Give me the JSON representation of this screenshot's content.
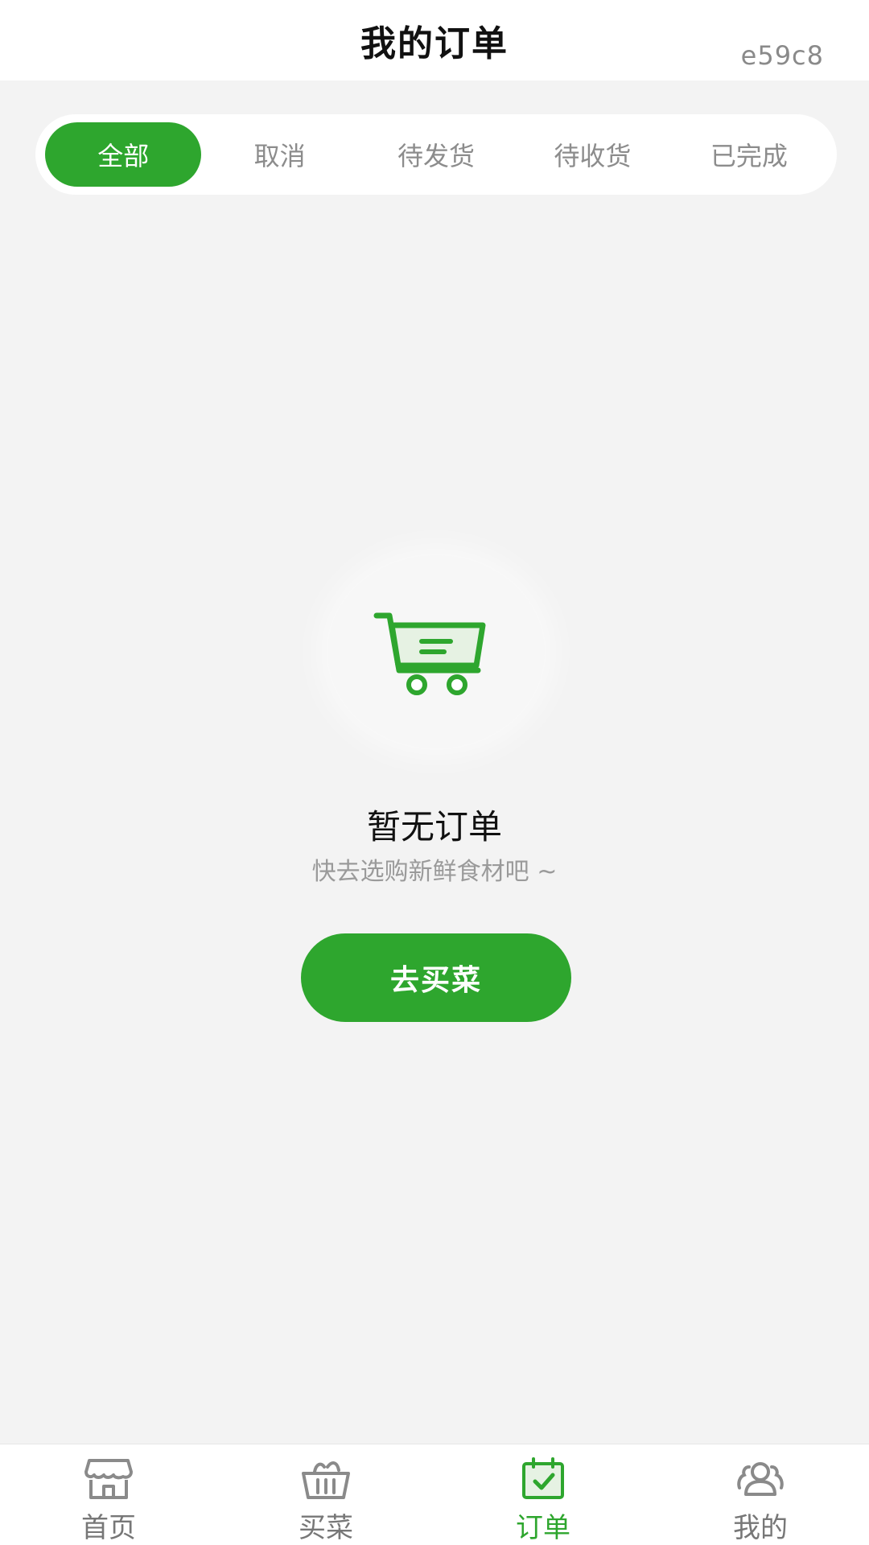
{
  "header": {
    "title": "我的订单",
    "build_id": "e59c8"
  },
  "tabs": [
    {
      "label": "全部",
      "active": true
    },
    {
      "label": "取消",
      "active": false
    },
    {
      "label": "待发货",
      "active": false
    },
    {
      "label": "待收货",
      "active": false
    },
    {
      "label": "已完成",
      "active": false
    }
  ],
  "empty_state": {
    "icon": "shopping-cart-icon",
    "title": "暂无订单",
    "subtitle": "快去选购新鲜食材吧 ~",
    "button_label": "去买菜"
  },
  "bottom_nav": [
    {
      "label": "首页",
      "icon": "store-icon",
      "active": false
    },
    {
      "label": "买菜",
      "icon": "basket-icon",
      "active": false
    },
    {
      "label": "订单",
      "icon": "order-calendar-icon",
      "active": true
    },
    {
      "label": "我的",
      "icon": "users-icon",
      "active": false
    }
  ],
  "colors": {
    "accent": "#2ea62e",
    "background": "#f3f3f3",
    "muted_text": "#8c8c8c"
  }
}
